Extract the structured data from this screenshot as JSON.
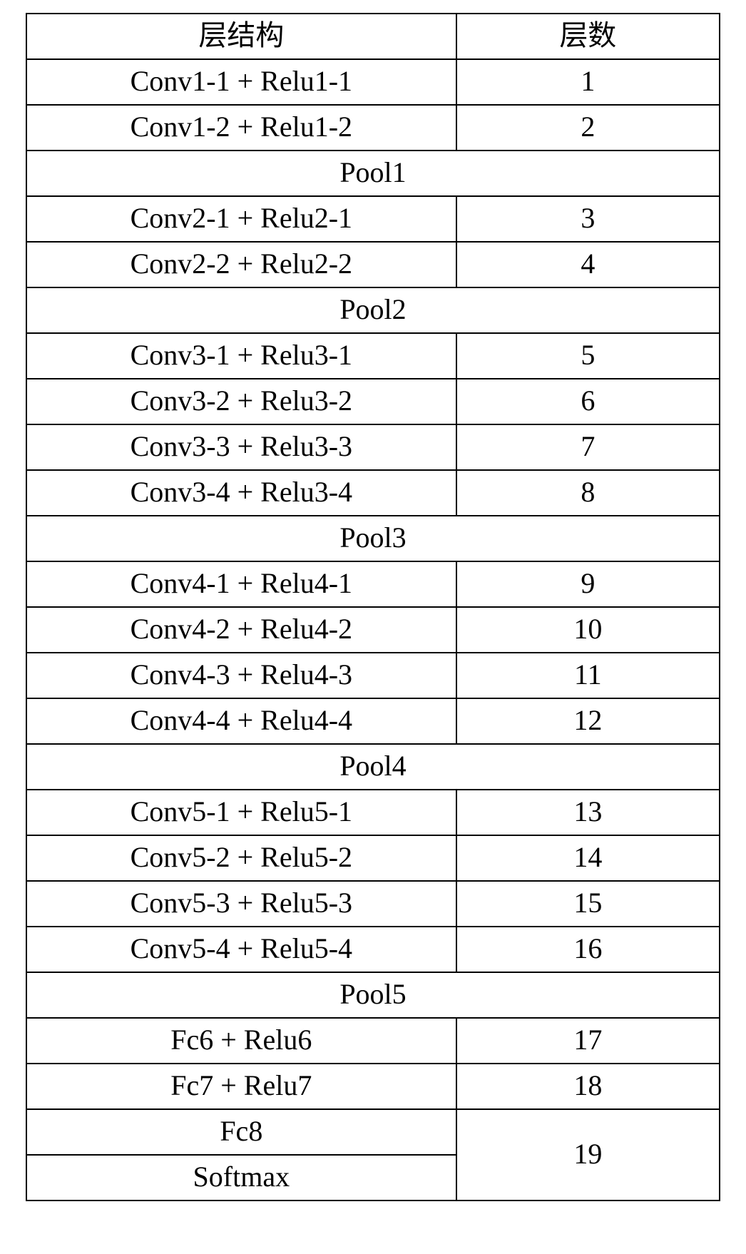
{
  "table": {
    "header": {
      "structure": "层结构",
      "number": "层数"
    },
    "rows": [
      {
        "type": "pair",
        "structure": "Conv1-1 + Relu1-1",
        "number": "1"
      },
      {
        "type": "pair",
        "structure": "Conv1-2 + Relu1-2",
        "number": "2"
      },
      {
        "type": "span",
        "label": "Pool1"
      },
      {
        "type": "pair",
        "structure": "Conv2-1 + Relu2-1",
        "number": "3"
      },
      {
        "type": "pair",
        "structure": "Conv2-2 + Relu2-2",
        "number": "4"
      },
      {
        "type": "span",
        "label": "Pool2"
      },
      {
        "type": "pair",
        "structure": "Conv3-1 + Relu3-1",
        "number": "5"
      },
      {
        "type": "pair",
        "structure": "Conv3-2 + Relu3-2",
        "number": "6"
      },
      {
        "type": "pair",
        "structure": "Conv3-3 + Relu3-3",
        "number": "7"
      },
      {
        "type": "pair",
        "structure": "Conv3-4 + Relu3-4",
        "number": "8"
      },
      {
        "type": "span",
        "label": "Pool3"
      },
      {
        "type": "pair",
        "structure": "Conv4-1 + Relu4-1",
        "number": "9"
      },
      {
        "type": "pair",
        "structure": "Conv4-2 + Relu4-2",
        "number": "10"
      },
      {
        "type": "pair",
        "structure": "Conv4-3 + Relu4-3",
        "number": "11"
      },
      {
        "type": "pair",
        "structure": "Conv4-4 + Relu4-4",
        "number": "12"
      },
      {
        "type": "span",
        "label": "Pool4"
      },
      {
        "type": "pair",
        "structure": "Conv5-1 + Relu5-1",
        "number": "13"
      },
      {
        "type": "pair",
        "structure": "Conv5-2 + Relu5-2",
        "number": "14"
      },
      {
        "type": "pair",
        "structure": "Conv5-3 + Relu5-3",
        "number": "15"
      },
      {
        "type": "pair",
        "structure": "Conv5-4 + Relu5-4",
        "number": "16"
      },
      {
        "type": "span",
        "label": "Pool5"
      },
      {
        "type": "pair",
        "structure": "Fc6 + Relu6",
        "number": "17"
      },
      {
        "type": "pair",
        "structure": "Fc7 + Relu7",
        "number": "18"
      },
      {
        "type": "merged2",
        "structures": [
          "Fc8",
          "Softmax"
        ],
        "number": "19"
      }
    ]
  }
}
